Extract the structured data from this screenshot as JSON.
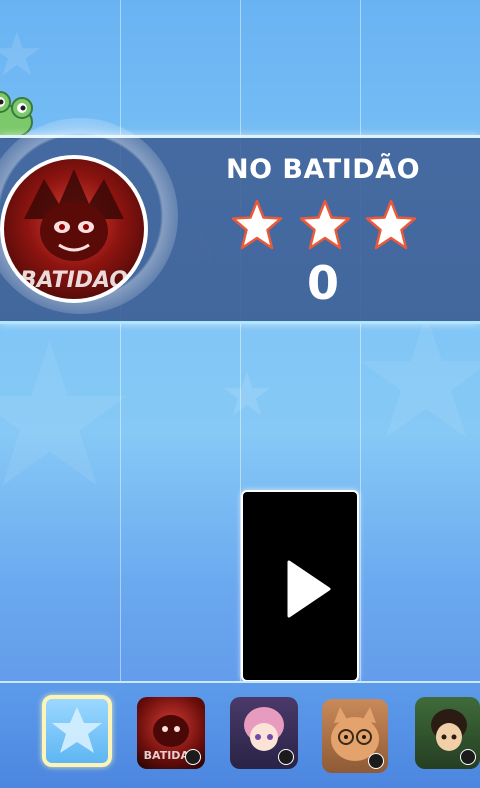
{
  "song": {
    "title": "NO BATIDÃO",
    "score": "0",
    "stars_total": 3,
    "stars_earned": 0
  },
  "colors": {
    "banner": "#3e5f96",
    "tile": "#000000",
    "star_fill": "#ffffff",
    "star_outline": "#e85a3a"
  },
  "icons": {
    "play": "play-icon",
    "lock": "lock-icon",
    "mascot": "frog-icon"
  },
  "song_list": {
    "items": [
      {
        "name": "star-pack",
        "locked": false,
        "selected": true
      },
      {
        "name": "batidao-cover",
        "locked": true,
        "selected": false
      },
      {
        "name": "anime-girl-cover",
        "locked": true,
        "selected": false
      },
      {
        "name": "cat-cover",
        "locked": true,
        "selected": false
      },
      {
        "name": "boy-cover",
        "locked": true,
        "selected": false
      }
    ]
  }
}
